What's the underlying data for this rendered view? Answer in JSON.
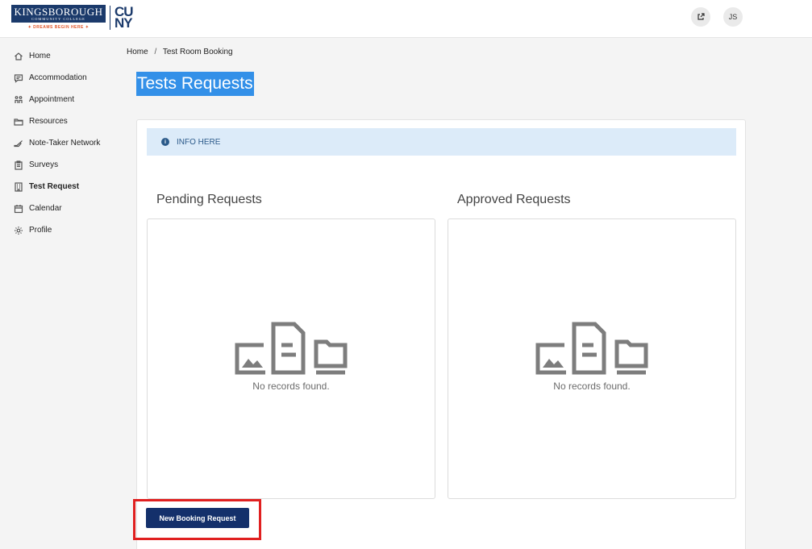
{
  "header": {
    "college_name": "KINGSBOROUGH",
    "college_sub": "COMMUNITY COLLEGE",
    "tagline": "✦ DREAMS BEGIN HERE ✦",
    "cuny_line1": "CU",
    "cuny_line2": "NY",
    "avatar_initials": "JS",
    "external_icon": "external-link-icon"
  },
  "sidebar": {
    "items": [
      {
        "label": "Home",
        "icon": "home-icon"
      },
      {
        "label": "Accommodation",
        "icon": "chat-icon"
      },
      {
        "label": "Appointment",
        "icon": "people-icon"
      },
      {
        "label": "Resources",
        "icon": "folder-icon"
      },
      {
        "label": "Note-Taker Network",
        "icon": "hand-icon"
      },
      {
        "label": "Surveys",
        "icon": "clipboard-icon"
      },
      {
        "label": "Test Request",
        "icon": "building-icon"
      },
      {
        "label": "Calendar",
        "icon": "calendar-icon"
      },
      {
        "label": "Profile",
        "icon": "gear-icon"
      }
    ],
    "active": "Test Request"
  },
  "breadcrumb": {
    "home": "Home",
    "separator": "/",
    "current": "Test Room Booking"
  },
  "page": {
    "title": "Tests Requests",
    "info_text": "INFO HERE",
    "pending_title": "Pending Requests",
    "approved_title": "Approved Requests",
    "pending_empty": "No records found.",
    "approved_empty": "No records found.",
    "new_button": "New Booking Request"
  },
  "colors": {
    "primary": "#14306b",
    "highlight": "#e02020",
    "info_bg": "#dcebf9",
    "title_selection": "#3390e8"
  }
}
